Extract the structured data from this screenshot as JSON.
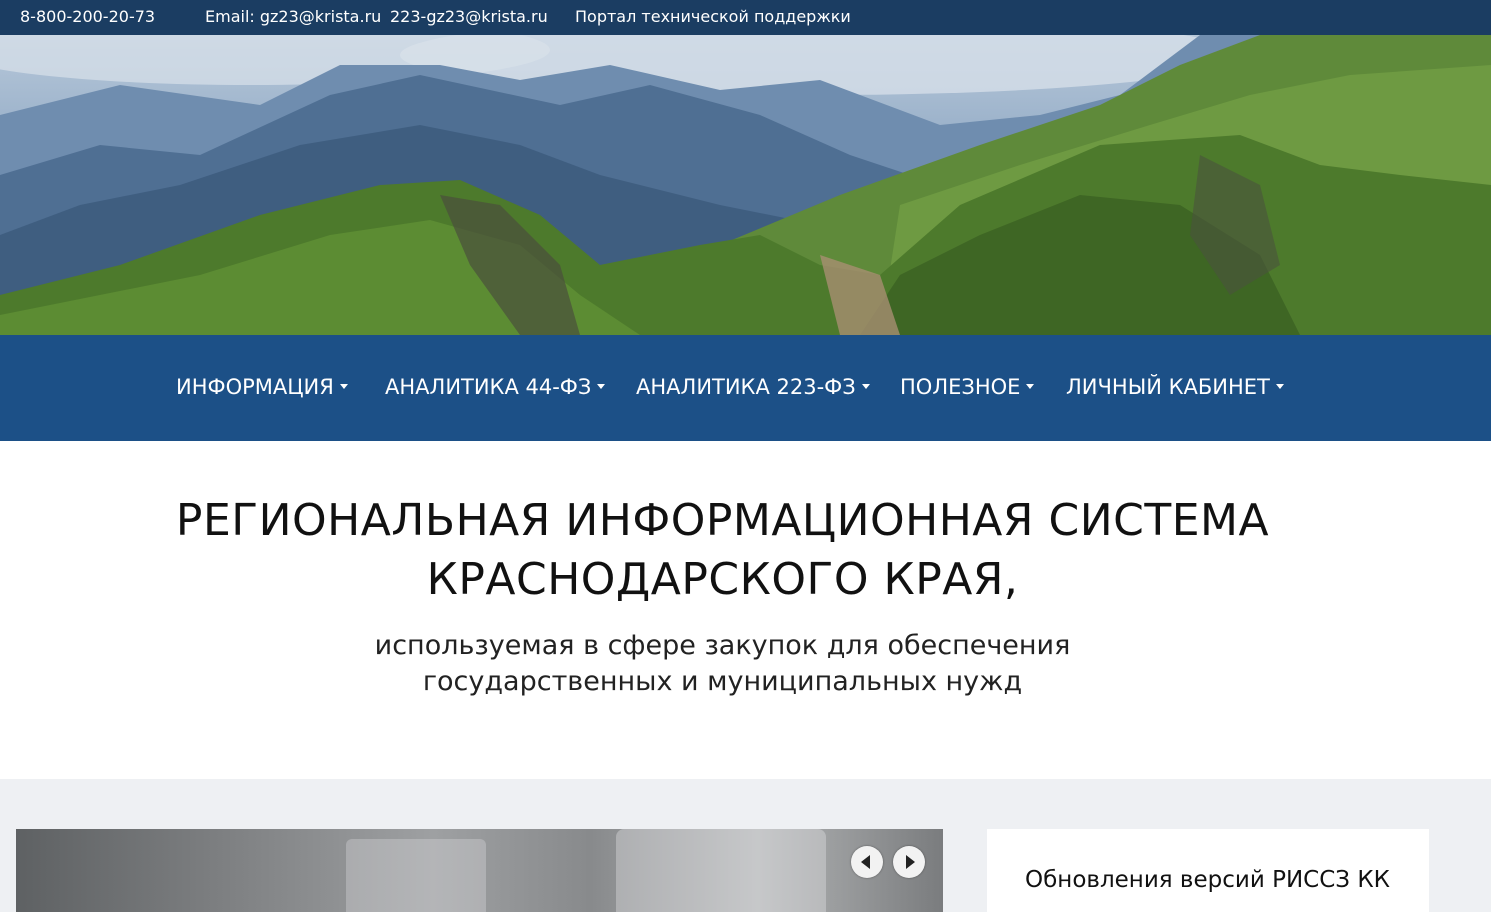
{
  "topbar": {
    "phone": "8-800-200-20-73",
    "email_label": "Email: gz23@krista.ru",
    "email2": "223-gz23@krista.ru",
    "support_link": "Портал технической поддержки"
  },
  "banner": {
    "image": "mountain-landscape"
  },
  "nav": {
    "items": [
      {
        "label": "ИНФОРМАЦИЯ"
      },
      {
        "label": "АНАЛИТИКА 44-ФЗ"
      },
      {
        "label": "АНАЛИТИКА 223-ФЗ"
      },
      {
        "label": "ПОЛЕЗНОЕ"
      },
      {
        "label": "ЛИЧНЫЙ КАБИНЕТ"
      }
    ]
  },
  "hero": {
    "title_line1": "РЕГИОНАЛЬНАЯ ИНФОРМАЦИОННАЯ СИСТЕМА",
    "title_line2": "КРАСНОДАРСКОГО КРАЯ,",
    "subtitle_line1": "используемая в сфере закупок для обеспечения",
    "subtitle_line2": "государственных и муниципальных нужд"
  },
  "slider": {
    "prev_icon": "chevron-left-icon",
    "next_icon": "chevron-right-icon"
  },
  "news": {
    "title": "Обновления версий РИССЗ КК"
  },
  "colors": {
    "topbar": "#1b3d62",
    "nav": "#1c5087",
    "content_bg": "#eef0f3"
  }
}
